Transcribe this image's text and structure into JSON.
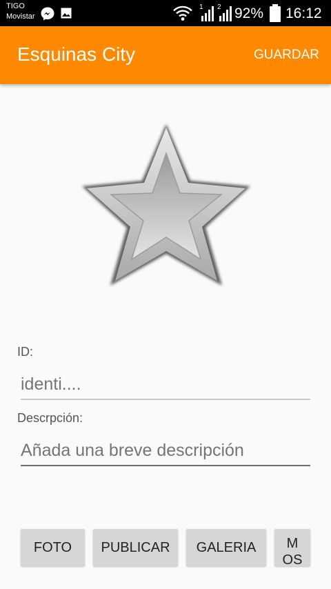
{
  "status_bar": {
    "carrier_1": "TIGO",
    "carrier_2": "Movistar",
    "sim_1": "1",
    "sim_2": "2",
    "battery": "92%",
    "time": "16:12",
    "icons": [
      "messenger-icon",
      "gallery-icon",
      "wifi-icon",
      "signal-icon",
      "signal-icon",
      "battery-icon"
    ]
  },
  "app_bar": {
    "title": "Esquinas City",
    "action": "GUARDAR",
    "color": "#fe8900"
  },
  "image": {
    "icon": "star-icon"
  },
  "form": {
    "id_label": "ID:",
    "id_placeholder": "identi....",
    "description_label": "Descrpción:",
    "description_placeholder": "Añada una breve descripción"
  },
  "buttons": {
    "photo": "FOTO",
    "publish": "PUBLICAR",
    "gallery": "GALERIA",
    "more_line_1": "M",
    "more_line_2": "OS"
  }
}
